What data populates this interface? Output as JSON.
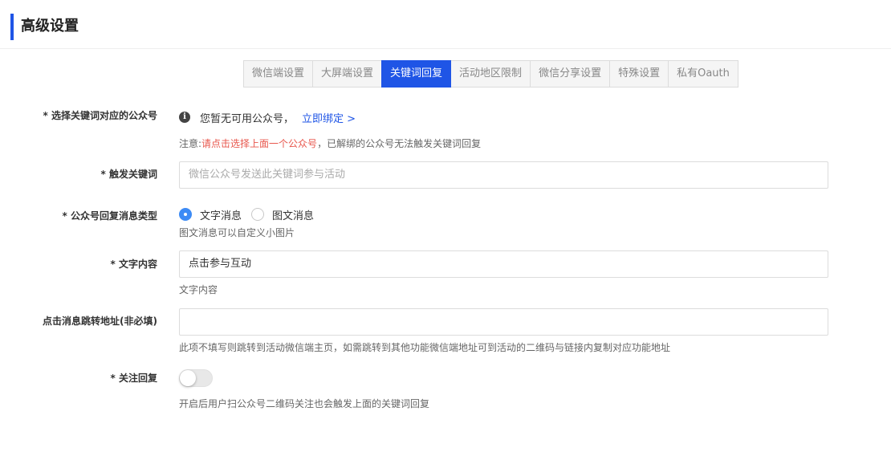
{
  "header": {
    "title": "高级设置"
  },
  "tabs": [
    {
      "label": "微信端设置",
      "active": false
    },
    {
      "label": "大屏端设置",
      "active": false
    },
    {
      "label": "关键词回复",
      "active": true
    },
    {
      "label": "活动地区限制",
      "active": false
    },
    {
      "label": "微信分享设置",
      "active": false
    },
    {
      "label": "特殊设置",
      "active": false
    },
    {
      "label": "私有Oauth",
      "active": false
    }
  ],
  "form": {
    "account": {
      "label": "* 选择关键词对应的公众号",
      "info_text": "您暂无可用公众号，",
      "bind_link": "立即绑定 >",
      "note_prefix": "注意:",
      "note_warn": "请点击选择上面一个公众号",
      "note_suffix": "，已解绑的公众号无法触发关键词回复"
    },
    "keyword": {
      "label": "* 触发关键词",
      "placeholder": "微信公众号发送此关键词参与活动"
    },
    "reply_type": {
      "label": "* 公众号回复消息类型",
      "options": [
        {
          "label": "文字消息",
          "checked": true
        },
        {
          "label": "图文消息",
          "checked": false
        }
      ],
      "help": "图文消息可以自定义小图片"
    },
    "text_content": {
      "label": "* 文字内容",
      "value": "点击参与互动",
      "help": "文字内容"
    },
    "jump_url": {
      "label": "点击消息跳转地址(非必填)",
      "value": "",
      "help": "此项不填写则跳转到活动微信端主页，如需跳转到其他功能微信端地址可到活动的二维码与链接内复制对应功能地址"
    },
    "follow_reply": {
      "label": "* 关注回复",
      "enabled": false,
      "help": "开启后用户扫公众号二维码关注也会触发上面的关键词回复"
    }
  },
  "colors": {
    "accent": "#1f55e6",
    "warn": "#e8574d",
    "radio": "#3d8bf5"
  }
}
